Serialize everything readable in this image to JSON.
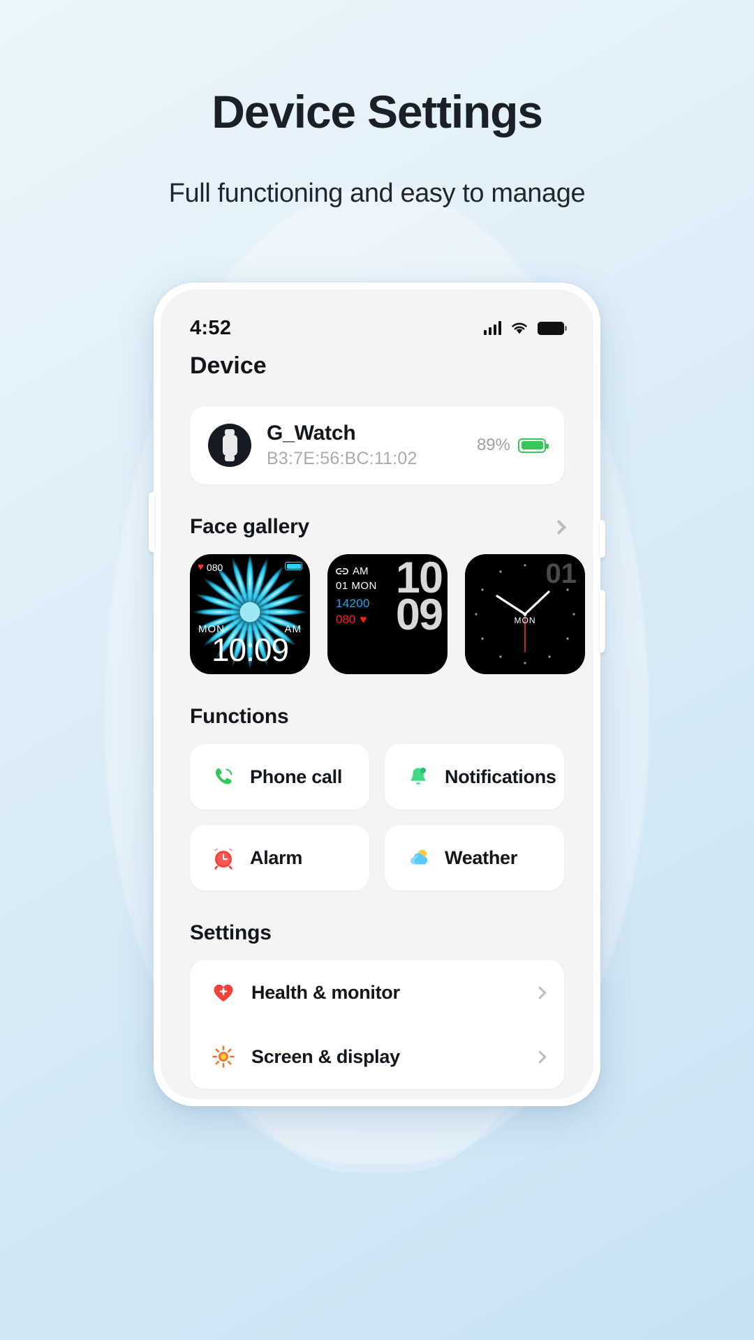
{
  "hero": {
    "title": "Device Settings",
    "subtitle": "Full functioning and easy to manage"
  },
  "status_bar": {
    "time": "4:52",
    "signal_icon": "cellular-signal-icon",
    "wifi_icon": "wifi-icon",
    "battery_icon": "battery-icon"
  },
  "screen": {
    "page_title": "Device"
  },
  "device": {
    "name": "G_Watch",
    "mac": "B3:7E:56:BC:11:02",
    "battery_percent": "89%",
    "battery_color": "#34c759",
    "avatar_icon": "smartwatch-icon"
  },
  "face_gallery": {
    "title": "Face gallery",
    "chevron_icon": "chevron-right-icon",
    "faces": [
      {
        "id": "face-flower",
        "heart_rate": "080",
        "weekday": "MON",
        "meridiem": "AM",
        "time": "10:09",
        "battery_color": "#2ad4ff",
        "heart_color": "#ff3b30"
      },
      {
        "id": "face-digital",
        "link_icon": "link-icon",
        "meridiem": "AM",
        "date": "01 MON",
        "steps": "14200",
        "steps_color": "#17a6ef",
        "heart_rate": "080",
        "heart_color": "#ff1e1e",
        "hour": "10",
        "minute": "09"
      },
      {
        "id": "face-analog",
        "digit": "01",
        "weekday": "MON"
      }
    ]
  },
  "functions": {
    "title": "Functions",
    "items": [
      {
        "label": "Phone call",
        "icon": "phone-icon",
        "color": "#34c759"
      },
      {
        "label": "Notifications",
        "icon": "bell-icon",
        "color": "#3ddc84"
      },
      {
        "label": "Alarm",
        "icon": "alarm-clock-icon",
        "color": "#f4413c"
      },
      {
        "label": "Weather",
        "icon": "weather-cloud-icon",
        "color": "#5ac8fa"
      }
    ]
  },
  "settings": {
    "title": "Settings",
    "items": [
      {
        "label": "Health & monitor",
        "icon": "heart-plus-icon",
        "color": "#f4413c",
        "chevron": "chevron-right-icon"
      },
      {
        "label": "Screen & display",
        "icon": "brightness-icon",
        "color": "#f0762a",
        "chevron": "chevron-right-icon"
      }
    ]
  }
}
